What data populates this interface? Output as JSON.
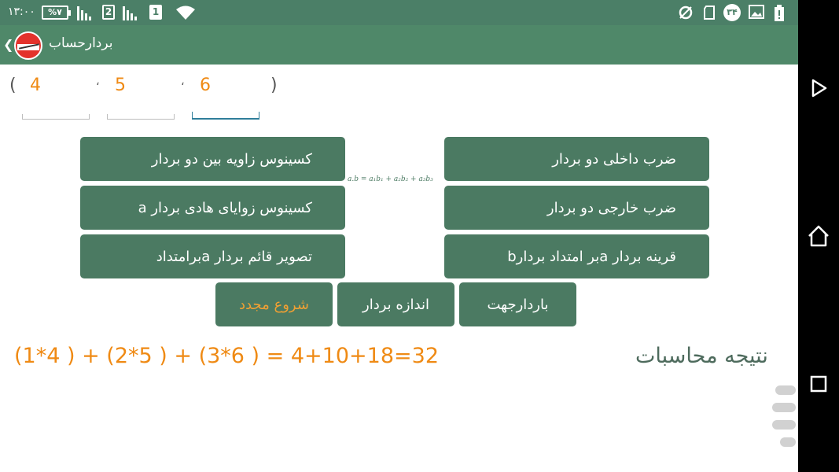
{
  "status_bar": {
    "time": "۱۳:۰۰",
    "battery": "%۷",
    "sim1": "2",
    "sim2": "1",
    "notification_badge": "۳۴"
  },
  "app_bar": {
    "title": "بردارحساب"
  },
  "vector": {
    "open_paren": "(",
    "close_paren": ")",
    "separator": "،",
    "components": [
      "4",
      "5",
      "6"
    ]
  },
  "formula": "a.b = a₁b₁ + a₂b₂ + a₃b₃",
  "buttons": {
    "dot_product": "ضرب داخلی دو بردار",
    "cross_product": "ضرب خارجی دو بردار",
    "vector_reflection": "قرینه بردار aبر امتداد بردارb",
    "cosine_angle": "کسینوس زاویه بین دو بردار",
    "direction_cosines": "کسینوس زوایای هادی بردار a",
    "orthogonal_projection": "تصویر قائم بردار aبرامتداد",
    "unit_vector": "باردارجهت",
    "magnitude": "اندازه بردار",
    "restart": "شروع مجدد"
  },
  "result": {
    "label": "نتیجه محاسبات",
    "value": "(1*4 ) + (2*5 ) + (3*6 )   =   4+10+18=32"
  },
  "colors": {
    "primary": "#4b7a62",
    "accent": "#ef8a14",
    "status_bar": "#4b7f67",
    "app_bar": "#4f8869"
  }
}
